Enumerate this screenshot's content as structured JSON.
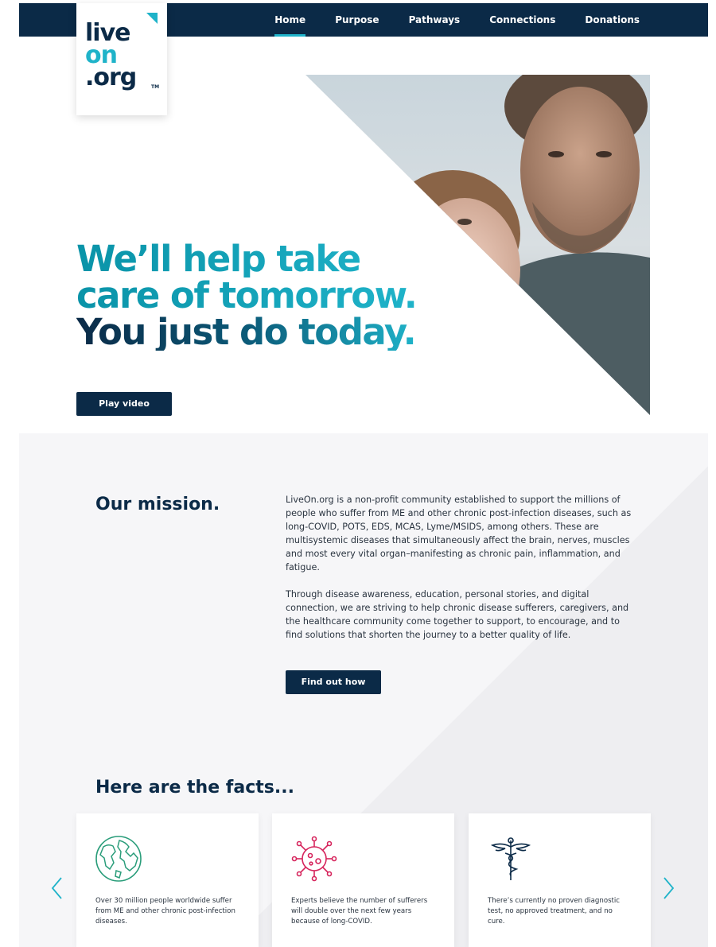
{
  "nav": {
    "items": [
      {
        "label": "Home",
        "active": true
      },
      {
        "label": "Purpose",
        "active": false
      },
      {
        "label": "Pathways",
        "active": false
      },
      {
        "label": "Connections",
        "active": false
      },
      {
        "label": "Donations",
        "active": false
      }
    ]
  },
  "logo": {
    "line1": "live",
    "line2": "on",
    "line3": ".org",
    "tm": "TM"
  },
  "hero": {
    "line1": "We’ll help take",
    "line2": "care of tomorrow.",
    "line3": "You just do today.",
    "play_label": "Play video"
  },
  "mission": {
    "title": "Our mission.",
    "para1": "LiveOn.org is a non-profit community established to support the millions of people who suffer from ME and other chronic post-infection diseases, such as long-COVID, POTS, EDS, MCAS, Lyme/MSIDS, among others. These are multisystemic diseases that simultaneously affect the brain, nerves, muscles and most every vital organ–manifesting as chronic pain, inflammation, and fatigue.",
    "para2": "Through disease awareness, education, personal stories, and digital connection, we are striving to help chronic disease sufferers, caregivers, and the healthcare community come together to support, to encourage, and to find solutions that shorten the journey to a better quality of life.",
    "cta_label": "Find out how"
  },
  "facts": {
    "title": "Here are the facts...",
    "cards": [
      {
        "icon": "globe-icon",
        "text": "Over 30 million people worldwide suffer from ME and other chronic post-infection diseases."
      },
      {
        "icon": "virus-icon",
        "text": "Experts believe the number of sufferers will double over the next few years because of long-COVID."
      },
      {
        "icon": "caduceus-icon",
        "text": "There’s currently no proven diagnostic test, no approved treatment, and no cure."
      }
    ]
  },
  "colors": {
    "navy": "#0b2a47",
    "teal": "#1fb3c9",
    "green": "#2a9d7a",
    "pink": "#d6245c"
  }
}
